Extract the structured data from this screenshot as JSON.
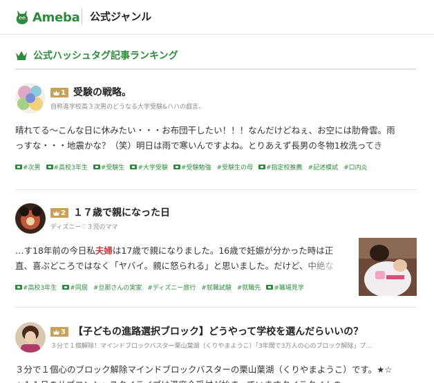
{
  "header": {
    "logo_text": "Ameba",
    "genre_title": "公式ジャンル"
  },
  "section": {
    "title": "公式ハッシュタグ記事ランキング"
  },
  "colors": {
    "brand_green": "#2d8c3c",
    "rank_gold": "#c7a15a"
  },
  "entries": [
    {
      "rank": "1",
      "title": "受験の戦略。",
      "blog_name": "自称進学校高３次男のどうなる大学受験&ハハの戯言。",
      "excerpt_line1": "晴れてる〜こんな日に休みたい・・・お布団干したい！！！なんだけどねぇ、お空には肋骨雲。雨",
      "excerpt_line2": "っすな・・・地震かな？（笑）明日は雨で寒いんですよね。とりあえず長男の冬物1枚洗ってき",
      "hashtags": [
        "#次男",
        "#高校3年生",
        "#受験生",
        "#大学受験",
        "#受験勉強",
        "#受験生の母",
        "#指定校推薦",
        "#記述模試",
        "#口内炎"
      ],
      "tag_has_pr": [
        true,
        true,
        true,
        true,
        true,
        false,
        true,
        false,
        false
      ]
    },
    {
      "rank": "2",
      "title": "１７歳で親になった日",
      "blog_name": "ディズニー♡３児のママ",
      "excerpt_line1_a": "…す18年前の今日私",
      "excerpt_line1_hl": "夫婦",
      "excerpt_line1_b": "は17歳で親になりました。16歳で妊娠が分かった時は正",
      "excerpt_line2": "直、喜ぶどころではなく「ヤバイ。親に怒られる」と思いました。だけど、中絶な",
      "hashtags": [
        "#高校3年生",
        "#同居",
        "#旦那さんの実家",
        "#ディズニー旅行",
        "#就職試験",
        "#就職先",
        "#職場見学"
      ],
      "tag_has_pr": [
        true,
        true,
        false,
        false,
        false,
        false,
        true
      ]
    },
    {
      "rank": "3",
      "title": "【子どもの進路選択ブロック】どうやって学校を選んだらいいの？",
      "blog_name": "３分で１個解除！マインドブロックバスター栗山葉湖（くりやまようこ）「3年間で3万人の心のブロック解除」プ…",
      "excerpt_line1": "３分で１個心のブロック解除マインドブロックバスターの栗山葉湖（くりやまようこ）です。★☆",
      "excerpt_line2": "★１１月のサブコンシャスタイライブは満席全受付が始まっていますタイラタイムの…"
    }
  ]
}
